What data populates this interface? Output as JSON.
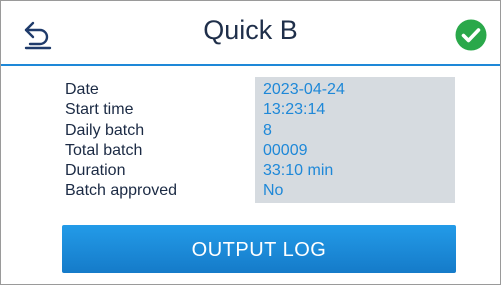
{
  "header": {
    "title": "Quick B",
    "back_icon": "back-arrow-icon",
    "status_icon": "checkmark-circle-icon",
    "status_color": "#2aa84a"
  },
  "details": [
    {
      "label": "Date",
      "value": "2023-04-24"
    },
    {
      "label": "Start time",
      "value": "13:23:14"
    },
    {
      "label": "Daily batch",
      "value": "8"
    },
    {
      "label": "Total batch",
      "value": "00009"
    },
    {
      "label": "Duration",
      "value": "33:10 min"
    },
    {
      "label": "Batch approved",
      "value": "No"
    }
  ],
  "actions": {
    "output_log_label": "OUTPUT LOG"
  },
  "colors": {
    "accent": "#1e88d8",
    "value_box": "#d6dbe0",
    "text": "#1b2a44"
  }
}
